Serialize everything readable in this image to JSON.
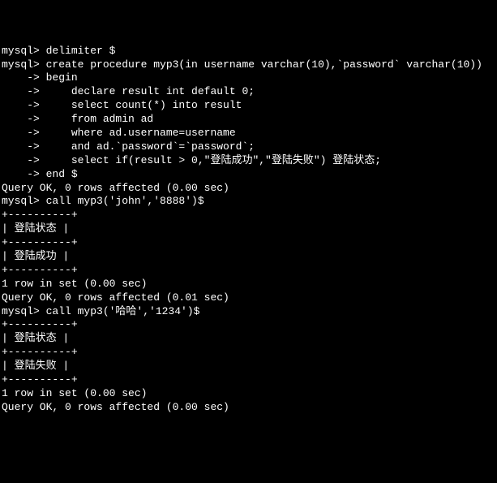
{
  "lines": [
    "mysql> delimiter $",
    "mysql> create procedure myp3(in username varchar(10),`password` varchar(10))",
    "    -> begin",
    "    ->     declare result int default 0;",
    "    ->     select count(*) into result",
    "    ->     from admin ad",
    "    ->     where ad.username=username",
    "    ->     and ad.`password`=`password`;",
    "    ->     select if(result > 0,\"登陆成功\",\"登陆失败\") 登陆状态;",
    "    -> end $",
    "Query OK, 0 rows affected (0.00 sec)",
    "",
    "mysql> call myp3('john','8888')$",
    "+----------+",
    "| 登陆状态 |",
    "+----------+",
    "| 登陆成功 |",
    "+----------+",
    "1 row in set (0.00 sec)",
    "",
    "Query OK, 0 rows affected (0.01 sec)",
    "",
    "mysql> call myp3('哈哈','1234')$",
    "+----------+",
    "| 登陆状态 |",
    "+----------+",
    "| 登陆失败 |",
    "+----------+",
    "1 row in set (0.00 sec)",
    "",
    "Query OK, 0 rows affected (0.00 sec)"
  ]
}
